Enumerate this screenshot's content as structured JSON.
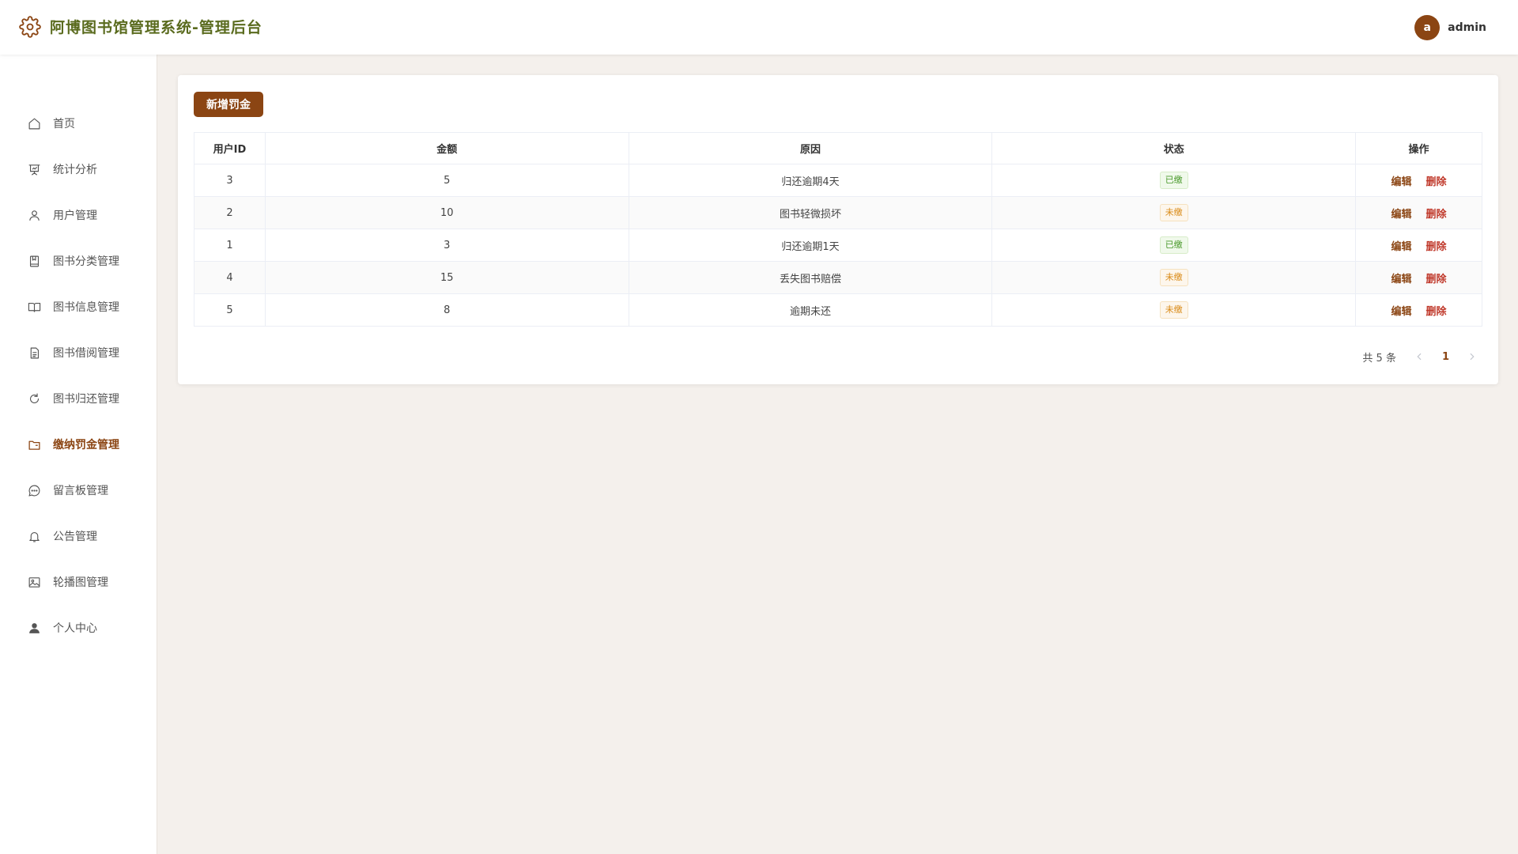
{
  "header": {
    "title": "阿博图书馆管理系统-管理后台",
    "logo_icon": "gear-icon",
    "avatar_letter": "a",
    "username": "admin"
  },
  "colors": {
    "accent": "#8b4513",
    "title": "#5a6b1e",
    "background": "#f4f0ec",
    "paid": "#4a9a2c",
    "unpaid": "#d98a16",
    "delete": "#c0392b"
  },
  "sidebar": {
    "items": [
      {
        "label": "首页",
        "icon": "home-icon"
      },
      {
        "label": "统计分析",
        "icon": "presentation-icon"
      },
      {
        "label": "用户管理",
        "icon": "user-icon"
      },
      {
        "label": "图书分类管理",
        "icon": "bookmark-icon"
      },
      {
        "label": "图书信息管理",
        "icon": "book-open-icon"
      },
      {
        "label": "图书借阅管理",
        "icon": "document-icon"
      },
      {
        "label": "图书归还管理",
        "icon": "refresh-icon"
      },
      {
        "label": "缴纳罚金管理",
        "icon": "folder-icon",
        "active": true
      },
      {
        "label": "留言板管理",
        "icon": "chat-icon"
      },
      {
        "label": "公告管理",
        "icon": "bell-icon"
      },
      {
        "label": "轮播图管理",
        "icon": "image-icon"
      },
      {
        "label": "个人中心",
        "icon": "person-filled-icon"
      }
    ]
  },
  "main": {
    "add_button": "新增罚金",
    "table": {
      "columns": [
        "用户ID",
        "金额",
        "原因",
        "状态",
        "操作"
      ],
      "rows": [
        {
          "user_id": "3",
          "amount": "5",
          "reason": "归还逾期4天",
          "status": "已缴"
        },
        {
          "user_id": "2",
          "amount": "10",
          "reason": "图书轻微损坏",
          "status": "未缴"
        },
        {
          "user_id": "1",
          "amount": "3",
          "reason": "归还逾期1天",
          "status": "已缴"
        },
        {
          "user_id": "4",
          "amount": "15",
          "reason": "丢失图书赔偿",
          "status": "未缴"
        },
        {
          "user_id": "5",
          "amount": "8",
          "reason": "逾期未还",
          "status": "未缴"
        }
      ],
      "edit_label": "编辑",
      "delete_label": "删除"
    },
    "pagination": {
      "total_text": "共 5 条",
      "current_page": "1"
    }
  }
}
